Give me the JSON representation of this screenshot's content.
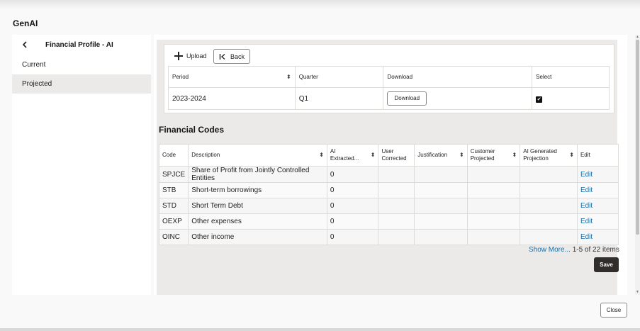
{
  "app": {
    "title": "GenAI"
  },
  "left_panel": {
    "title": "Financial Profile - AI",
    "items": [
      {
        "label": "Current",
        "selected": false
      },
      {
        "label": "Projected",
        "selected": true
      }
    ]
  },
  "toolbar": {
    "upload_label": "Upload",
    "back_label": "Back"
  },
  "period_table": {
    "headers": {
      "period": "Period",
      "quarter": "Quarter",
      "download": "Download",
      "select": "Select"
    },
    "rows": [
      {
        "period": "2023-2024",
        "quarter": "Q1",
        "download_label": "Download",
        "selected": true
      }
    ]
  },
  "financial_codes": {
    "title": "Financial Codes",
    "headers": {
      "code": "Code",
      "description": "Description",
      "ai_extracted": "AI Extracted...",
      "user_corrected": "User Corrected",
      "justification": "Justification",
      "customer_projected": "Customer Projected",
      "ai_generated_projection": "AI Generated Projection",
      "edit": "Edit"
    },
    "rows": [
      {
        "code": "SPJCE",
        "description": "Share of Profit from Jointly Controlled Entities",
        "ai_extracted": "0",
        "edit": "Edit"
      },
      {
        "code": "STB",
        "description": "Short-term borrowings",
        "ai_extracted": "0",
        "edit": "Edit"
      },
      {
        "code": "STD",
        "description": "Short Term Debt",
        "ai_extracted": "0",
        "edit": "Edit"
      },
      {
        "code": "OEXP",
        "description": "Other expenses",
        "ai_extracted": "0",
        "edit": "Edit"
      },
      {
        "code": "OINC",
        "description": "Other income",
        "ai_extracted": "0",
        "edit": "Edit"
      }
    ],
    "show_more": "Show More...",
    "range_text": "1-5 of 22 items"
  },
  "actions": {
    "save_label": "Save",
    "close_label": "Close"
  },
  "colors": {
    "link": "#1a6fa8",
    "primary_button": "#312d2a",
    "selected_nav": "#ebeae8"
  }
}
